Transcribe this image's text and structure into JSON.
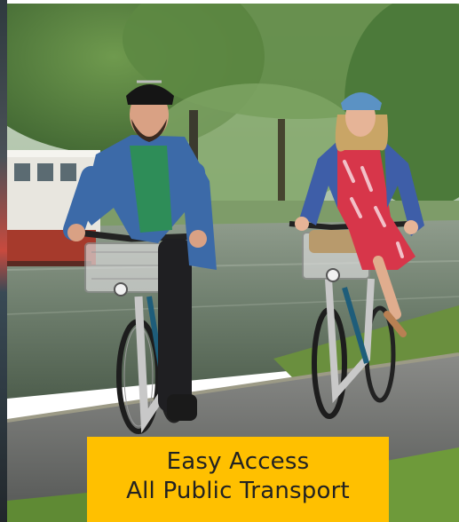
{
  "photo": {
    "subject": "bike-share-photo"
  },
  "caption": {
    "line1": "Easy Access",
    "line2": "All Public Transport",
    "background_color": "#FFC000",
    "text_color": "#222222"
  }
}
